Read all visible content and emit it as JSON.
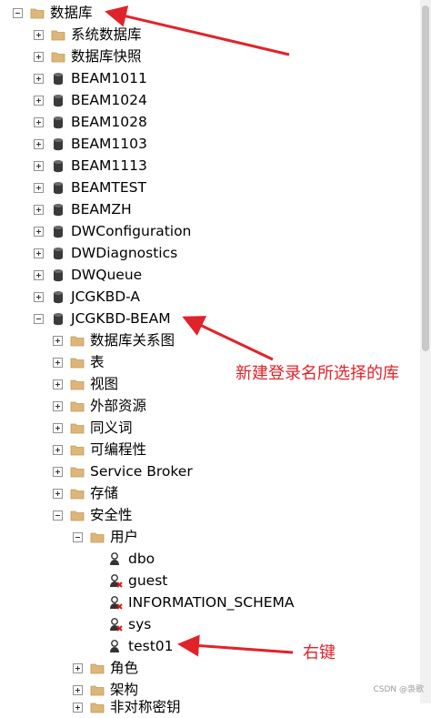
{
  "tree": {
    "root": {
      "label": "数据库"
    },
    "top_items": [
      {
        "label": "系统数据库",
        "icon": "folder-icon"
      },
      {
        "label": "数据库快照",
        "icon": "folder-icon"
      },
      {
        "label": "BEAM1011",
        "icon": "database-icon"
      },
      {
        "label": "BEAM1024",
        "icon": "database-icon"
      },
      {
        "label": "BEAM1028",
        "icon": "database-icon"
      },
      {
        "label": "BEAM1103",
        "icon": "database-icon"
      },
      {
        "label": "BEAM1113",
        "icon": "database-icon"
      },
      {
        "label": "BEAMTEST",
        "icon": "database-icon"
      },
      {
        "label": "BEAMZH",
        "icon": "database-icon"
      },
      {
        "label": "DWConfiguration",
        "icon": "database-icon"
      },
      {
        "label": "DWDiagnostics",
        "icon": "database-icon"
      },
      {
        "label": "DWQueue",
        "icon": "database-icon"
      },
      {
        "label": "JCGKBD-A",
        "icon": "database-icon"
      }
    ],
    "expanded_db": {
      "label": "JCGKBD-BEAM"
    },
    "db_children": [
      {
        "label": "数据库关系图"
      },
      {
        "label": "表"
      },
      {
        "label": "视图"
      },
      {
        "label": "外部资源"
      },
      {
        "label": "同义词"
      },
      {
        "label": "可编程性"
      },
      {
        "label": "Service Broker"
      },
      {
        "label": "存储"
      }
    ],
    "security": {
      "label": "安全性"
    },
    "users_folder": {
      "label": "用户"
    },
    "users": [
      {
        "label": "dbo",
        "disabled": false
      },
      {
        "label": "guest",
        "disabled": true
      },
      {
        "label": "INFORMATION_SCHEMA",
        "disabled": true
      },
      {
        "label": "sys",
        "disabled": true
      },
      {
        "label": "test01",
        "disabled": false
      }
    ],
    "security_children": [
      {
        "label": "角色"
      },
      {
        "label": "架构"
      }
    ],
    "partial_row": {
      "label": "非对称密钥"
    }
  },
  "annotations": {
    "note_db": "新建登录名所选择的库",
    "note_right_click": "右键",
    "color": "#e0232b"
  },
  "watermark": "CSDN @袅歌"
}
